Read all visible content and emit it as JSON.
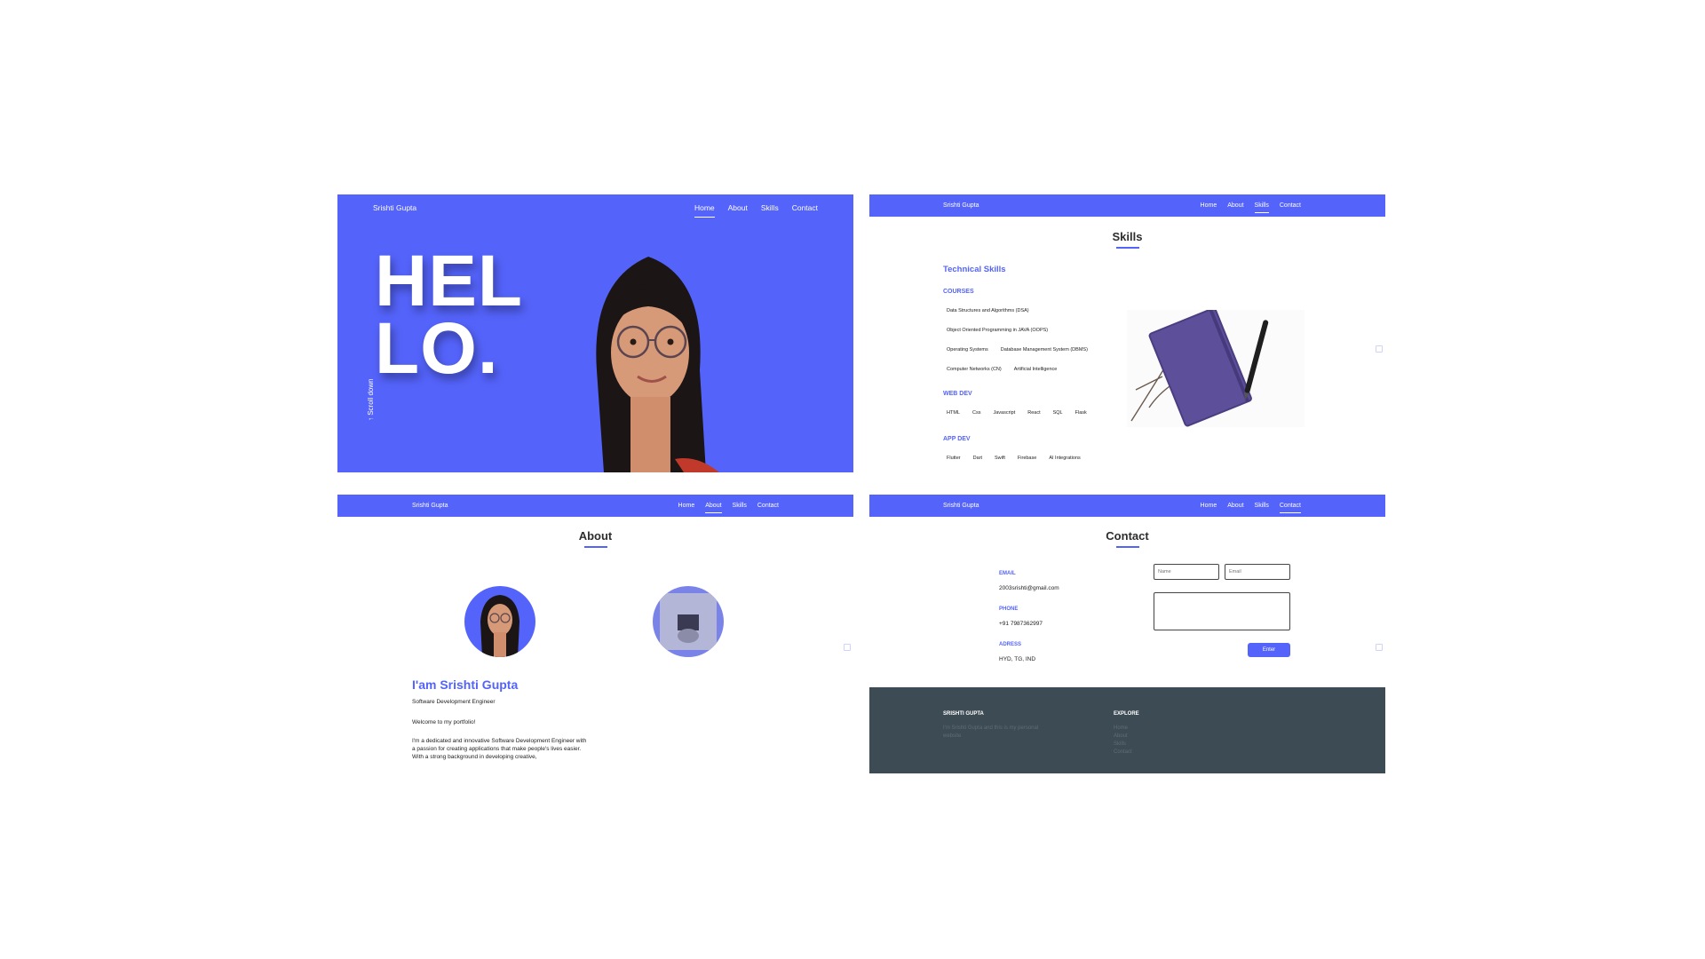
{
  "brand": "Srishti Gupta",
  "nav": [
    "Home",
    "About",
    "Skills",
    "Contact"
  ],
  "home": {
    "hello_line1": "HEL",
    "hello_line2": "LO.",
    "scroll": "↑ Scroll down"
  },
  "skills": {
    "title": "Skills",
    "heading": "Technical Skills",
    "courses_label": "COURSES",
    "courses": [
      [
        "Data Structures and Algorithms (DSA)"
      ],
      [
        "Object Oriented Programming in JAVA (OOPS)"
      ],
      [
        "Operating Systems",
        "Database Management System (DBMS)"
      ],
      [
        "Computer Networks (CN)",
        "Artificial Intelligence"
      ]
    ],
    "webdev_label": "WEB DEV",
    "webdev": [
      "HTML",
      "Css",
      "Javascript",
      "React",
      "SQL",
      "Flask"
    ],
    "appdev_label": "APP DEV",
    "appdev": [
      "Flutter",
      "Dart",
      "Swift",
      "Firebase",
      "AI Integrations"
    ]
  },
  "about": {
    "title": "About",
    "name": "I'am Srishti Gupta",
    "role": "Software Development Engineer",
    "welcome": "Welcome to my portfolio!",
    "para": "I'm a dedicated and innovative Software Development Engineer with a passion for creating applications that make people's lives easier.",
    "para2": "With a strong background in developing creative,"
  },
  "contact": {
    "title": "Contact",
    "email_label": "EMAIL",
    "email": "2003srishti@gmail.com",
    "phone_label": "PHONE",
    "phone": "+91 7987362997",
    "address_label": "ADRESS",
    "address": "HYD, TG, IND",
    "name_placeholder": "Name",
    "email_placeholder": "Email",
    "button": "Enter"
  },
  "footer": {
    "title": "SRISHTI GUPTA",
    "desc": "I'm Srishti Gupta and this is my personal website",
    "explore_label": "EXPLORE",
    "links": [
      "Home",
      "About",
      "Skills",
      "Contact"
    ]
  },
  "colors": {
    "accent": "#5463fa",
    "footer": "#3d4b54"
  }
}
